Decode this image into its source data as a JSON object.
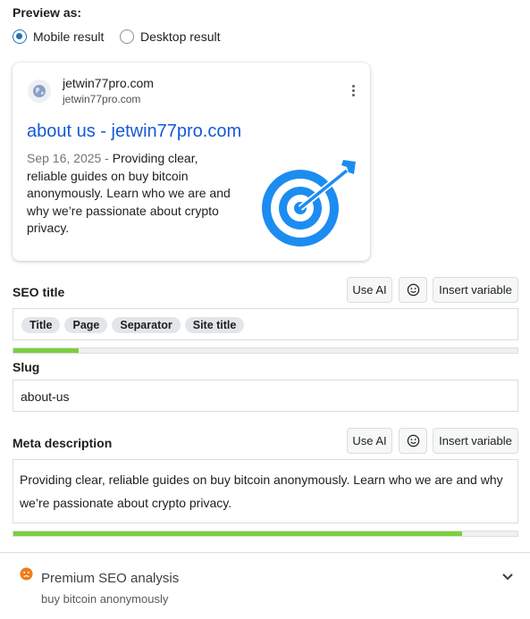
{
  "preview": {
    "label": "Preview as:",
    "options": [
      {
        "label": "Mobile result",
        "selected": true
      },
      {
        "label": "Desktop result",
        "selected": false
      }
    ]
  },
  "snippet": {
    "site_name": "jetwin77pro.com",
    "site_url": "jetwin77pro.com",
    "title": "about us - jetwin77pro.com",
    "date": "Sep 16, 2025",
    "separator": " - ",
    "description": "Providing clear, reliable guides on buy bitcoin anonymously. Learn who we are and why we’re passionate about crypto privacy.",
    "image_icon": "target-arrow-icon"
  },
  "seo_title": {
    "label": "SEO title",
    "buttons": {
      "ai": "Use AI",
      "emoji": "emoji-icon",
      "variable": "Insert variable"
    },
    "tokens": [
      "Title",
      "Page",
      "Separator",
      "Site title"
    ],
    "progress": 0.13
  },
  "slug": {
    "label": "Slug",
    "value": "about-us"
  },
  "meta": {
    "label": "Meta description",
    "buttons": {
      "ai": "Use AI",
      "emoji": "emoji-icon",
      "variable": "Insert variable"
    },
    "value": "Providing clear, reliable guides on buy bitcoin anonymously. Learn who we are and why we’re passionate about crypto privacy.",
    "progress": 0.89
  },
  "premium": {
    "title": "Premium SEO analysis",
    "subtitle": "buy bitcoin anonymously",
    "status_color": "#ee7c1b"
  },
  "colors": {
    "accent": "#2271b1",
    "link": "#1558d6",
    "progress_good": "#7ad03a",
    "target_blue": "#1d8cf0"
  }
}
